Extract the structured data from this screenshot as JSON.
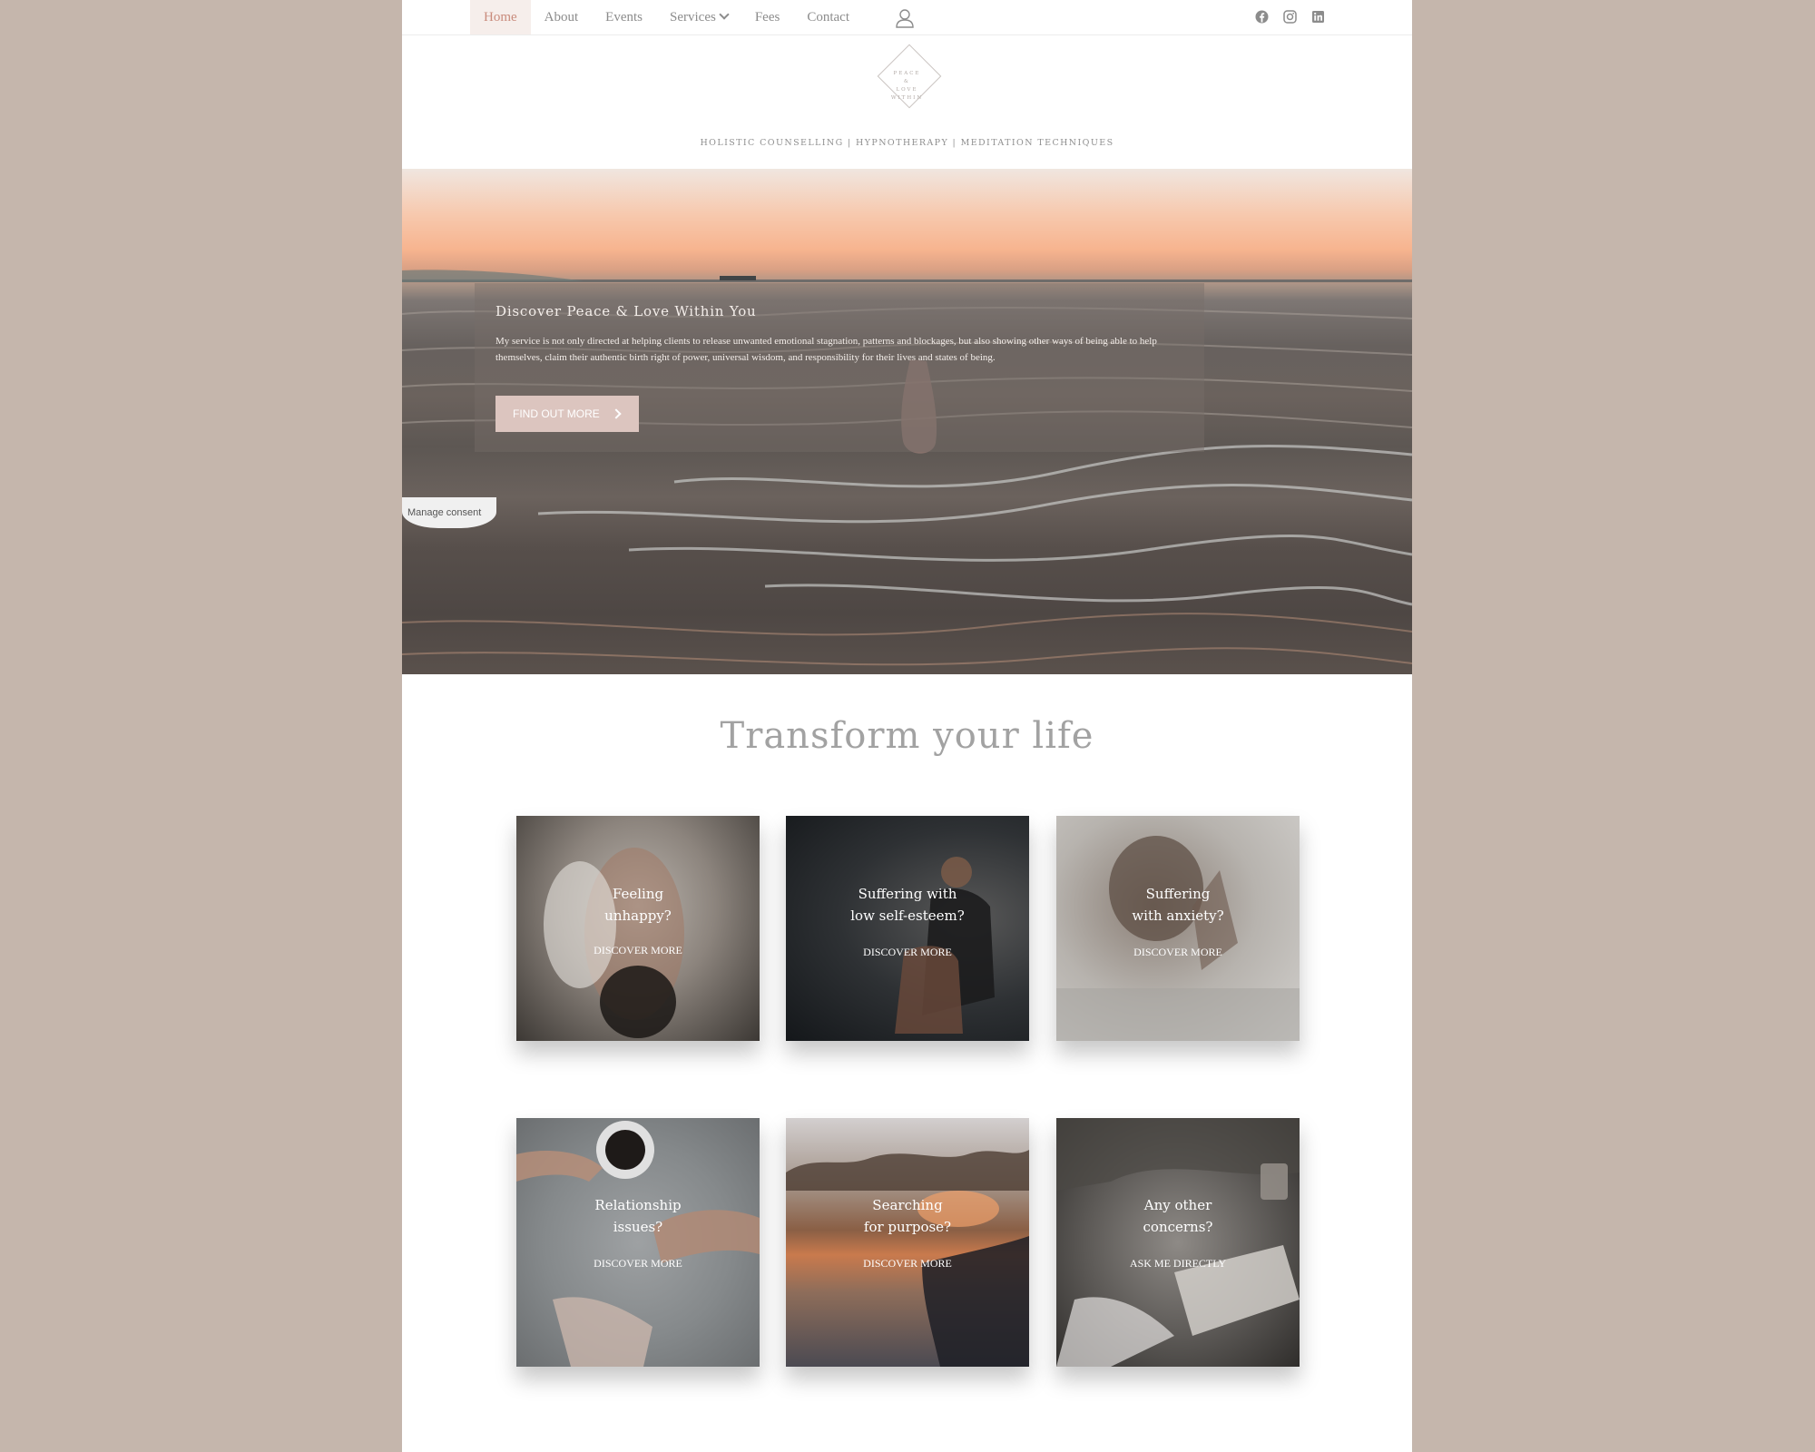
{
  "nav": {
    "items": [
      {
        "label": "Home",
        "active": true
      },
      {
        "label": "About"
      },
      {
        "label": "Events"
      },
      {
        "label": "Services",
        "has_dropdown": true
      },
      {
        "label": "Fees"
      },
      {
        "label": "Contact"
      }
    ],
    "user_icon": "user-icon",
    "social": [
      "facebook-icon",
      "instagram-icon",
      "linkedin-icon"
    ]
  },
  "logo": {
    "lines": [
      "PEACE",
      "&",
      "LOVE",
      "WITHIN"
    ]
  },
  "tagline": "HOLISTIC COUNSELLING | HYPNOTHERAPY | MEDITATION TECHNIQUES",
  "hero": {
    "title": "Discover Peace & Love Within You",
    "text": "My service is not only directed at helping clients to release unwanted emotional stagnation, patterns and blockages, but also showing other ways of being able to help themselves, claim their authentic birth right of power, universal wisdom, and responsibility for their lives and states of being.",
    "button_label": "FIND OUT MORE"
  },
  "consent_label": "Manage consent",
  "section_title": "Transform your life",
  "cards": [
    {
      "line1": "Feeling",
      "line2": "unhappy?",
      "cta": "DISCOVER MORE"
    },
    {
      "line1": "Suffering with",
      "line2": "low self-esteem?",
      "cta": "DISCOVER MORE"
    },
    {
      "line1": "Suffering",
      "line2": "with anxiety?",
      "cta": "DISCOVER MORE"
    },
    {
      "line1": "Relationship",
      "line2": "issues?",
      "cta": "DISCOVER MORE"
    },
    {
      "line1": "Searching",
      "line2": "for purpose?",
      "cta": "DISCOVER MORE"
    },
    {
      "line1": "Any other",
      "line2": "concerns?",
      "cta": "ASK ME DIRECTLY"
    }
  ],
  "colors": {
    "background": "#c5b6ac",
    "accent": "#c98b7c",
    "button": "#dcc5bf",
    "nav_text": "#8c8c8c"
  }
}
